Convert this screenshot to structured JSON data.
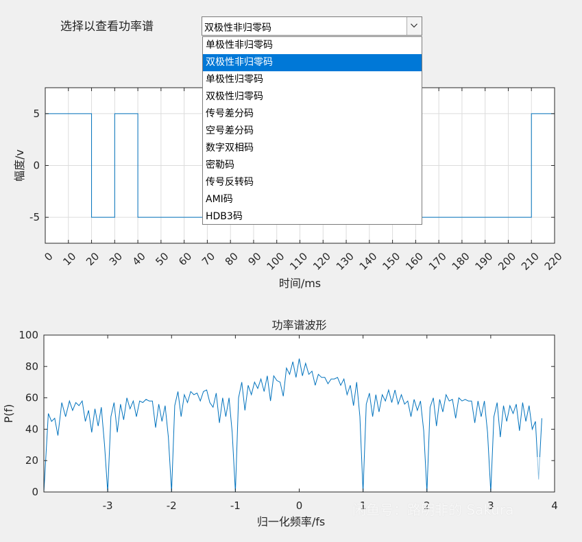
{
  "prompt": {
    "label": "选择以查看功率谱"
  },
  "dropdown": {
    "selected": "双极性非归零码",
    "options": [
      "单极性非归零码",
      "双极性非归零码",
      "单极性归零码",
      "双极性归零码",
      "传号差分码",
      "空号差分码",
      "数字双相码",
      "密勒码",
      "传号反转码",
      "AMI码",
      "HDB3码"
    ],
    "selected_index": 1
  },
  "colors": {
    "line": "#0072bd",
    "selection": "#0078d7",
    "grid": "#dcdcdc"
  },
  "chart_data": [
    {
      "type": "line",
      "title": "",
      "xlabel": "时间/ms",
      "ylabel": "幅度/v",
      "xlim": [
        0,
        220
      ],
      "ylim": [
        -7.5,
        7.5
      ],
      "xticks": [
        0,
        10,
        20,
        30,
        40,
        50,
        60,
        70,
        80,
        90,
        100,
        110,
        120,
        130,
        140,
        150,
        160,
        170,
        180,
        190,
        200,
        210,
        220
      ],
      "yticks": [
        -5,
        0,
        5
      ],
      "grid": true,
      "step": true,
      "x": [
        0,
        20,
        30,
        40,
        210,
        220
      ],
      "y": [
        5,
        -5,
        5,
        -5,
        5,
        5
      ]
    },
    {
      "type": "line",
      "title": "功率谱波形",
      "xlabel": "归一化频率/fs",
      "ylabel": "P(f)",
      "xlim": [
        -4,
        4
      ],
      "ylim": [
        0,
        100
      ],
      "xticks": [
        -3,
        -2,
        -1,
        0,
        1,
        2,
        3,
        4
      ],
      "yticks": [
        0,
        20,
        40,
        60,
        80,
        100
      ],
      "grid": false,
      "x": [
        -4,
        -3.93,
        -3.88,
        -3.83,
        -3.78,
        -3.72,
        -3.66,
        -3.6,
        -3.55,
        -3.5,
        -3.45,
        -3.4,
        -3.35,
        -3.3,
        -3.25,
        -3.2,
        -3.15,
        -3.1,
        -3.05,
        -3.0,
        -2.95,
        -2.9,
        -2.85,
        -2.8,
        -2.75,
        -2.7,
        -2.65,
        -2.6,
        -2.55,
        -2.5,
        -2.45,
        -2.4,
        -2.35,
        -2.3,
        -2.25,
        -2.2,
        -2.15,
        -2.1,
        -2.05,
        -2.0,
        -1.95,
        -1.9,
        -1.85,
        -1.8,
        -1.75,
        -1.7,
        -1.65,
        -1.6,
        -1.55,
        -1.5,
        -1.45,
        -1.4,
        -1.35,
        -1.3,
        -1.25,
        -1.2,
        -1.15,
        -1.1,
        -1.05,
        -1.0,
        -0.95,
        -0.9,
        -0.85,
        -0.8,
        -0.75,
        -0.7,
        -0.65,
        -0.6,
        -0.55,
        -0.5,
        -0.45,
        -0.4,
        -0.35,
        -0.3,
        -0.25,
        -0.2,
        -0.15,
        -0.1,
        -0.05,
        0.0,
        0.05,
        0.1,
        0.15,
        0.2,
        0.25,
        0.3,
        0.35,
        0.4,
        0.45,
        0.5,
        0.55,
        0.6,
        0.65,
        0.7,
        0.75,
        0.8,
        0.85,
        0.9,
        0.95,
        1.0,
        1.05,
        1.1,
        1.15,
        1.2,
        1.25,
        1.3,
        1.35,
        1.4,
        1.45,
        1.5,
        1.55,
        1.6,
        1.65,
        1.7,
        1.75,
        1.8,
        1.85,
        1.9,
        1.95,
        2.0,
        2.05,
        2.1,
        2.15,
        2.2,
        2.25,
        2.3,
        2.35,
        2.4,
        2.45,
        2.5,
        2.55,
        2.6,
        2.65,
        2.7,
        2.75,
        2.8,
        2.85,
        2.9,
        2.95,
        3.0,
        3.05,
        3.1,
        3.15,
        3.2,
        3.25,
        3.3,
        3.35,
        3.4,
        3.45,
        3.5,
        3.55,
        3.6,
        3.65,
        3.7,
        3.75,
        3.8,
        3.85,
        3.9,
        3.95,
        4.0
      ],
      "y": [
        0,
        50,
        45,
        47,
        36,
        57,
        48,
        58,
        52,
        57,
        55,
        58,
        45,
        52,
        38,
        53,
        42,
        54,
        30,
        0,
        48,
        57,
        38,
        56,
        46,
        60,
        53,
        58,
        48,
        58,
        57,
        59,
        58,
        58,
        41,
        56,
        45,
        55,
        35,
        0,
        55,
        64,
        48,
        62,
        57,
        64,
        62,
        63,
        58,
        64,
        65,
        57,
        54,
        63,
        44,
        60,
        48,
        60,
        38,
        0,
        60,
        70,
        52,
        68,
        62,
        70,
        66,
        72,
        64,
        74,
        58,
        74,
        71,
        70,
        61,
        79,
        75,
        83,
        73,
        85,
        74,
        82,
        75,
        77,
        68,
        75,
        73,
        73,
        69,
        72,
        72,
        73,
        68,
        72,
        62,
        68,
        55,
        70,
        48,
        0,
        56,
        63,
        48,
        62,
        51,
        62,
        58,
        65,
        57,
        65,
        56,
        62,
        56,
        58,
        48,
        59,
        52,
        58,
        39,
        0,
        54,
        60,
        42,
        59,
        51,
        62,
        58,
        59,
        47,
        60,
        58,
        59,
        58,
        58,
        44,
        58,
        48,
        58,
        38,
        0,
        48,
        57,
        35,
        55,
        45,
        55,
        50,
        56,
        39,
        57,
        45,
        55,
        40,
        45,
        8,
        47
      ]
    }
  ],
  "watermark": {
    "text": "闲鱼号：路明非的 Sakura",
    "logo": "闲鱼"
  }
}
